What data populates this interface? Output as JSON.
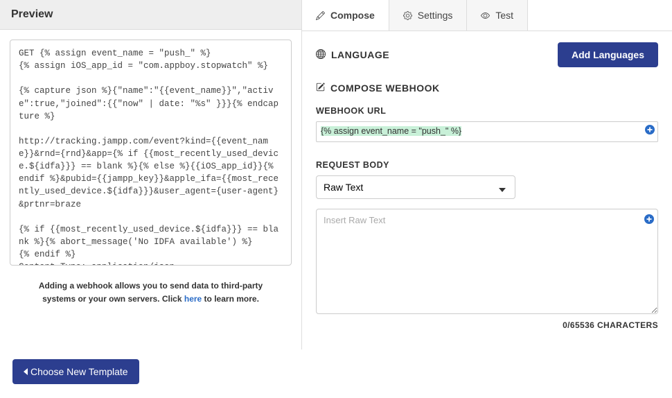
{
  "preview": {
    "title": "Preview",
    "code": "GET {% assign event_name = \"push_\" %}\n{% assign iOS_app_id = \"com.appboy.stopwatch\" %}\n\n{% capture json %}{\"name\":\"{{event_name}}\",\"active\":true,\"joined\":{{\"now\" | date: \"%s\" }}}{% endcapture %}\n\nhttp://tracking.jampp.com/event?kind={{event_name}}&rnd={rnd}&app={% if {{most_recently_used_device.${idfa}}} == blank %}{% else %}{{iOS_app_id}}{% endif %}&pubid={{jampp_key}}&apple_ifa={{most_recently_used_device.${idfa}}}&user_agent={user-agent}&prtnr=braze\n\n{% if {{most_recently_used_device.${idfa}}} == blank %}{% abort_message('No IDFA available') %}\n{% endif %}\nContent-Type: application/json",
    "help_text_before": "Adding a webhook allows you to send data to third-party systems or your own servers. Click ",
    "help_link": "here",
    "help_text_after": " to learn more."
  },
  "tabs": {
    "compose": "Compose",
    "settings": "Settings",
    "test": "Test"
  },
  "compose": {
    "language_label": "LANGUAGE",
    "add_languages": "Add Languages",
    "section_label": "COMPOSE WEBHOOK",
    "url_label": "WEBHOOK URL",
    "url_value": "{% assign event_name = \"push_\" %}",
    "body_label": "REQUEST BODY",
    "body_type": "Raw Text",
    "body_placeholder": "Insert Raw Text",
    "body_value": "",
    "char_count": "0/65536 CHARACTERS"
  },
  "footer": {
    "choose_template": "Choose New Template"
  }
}
